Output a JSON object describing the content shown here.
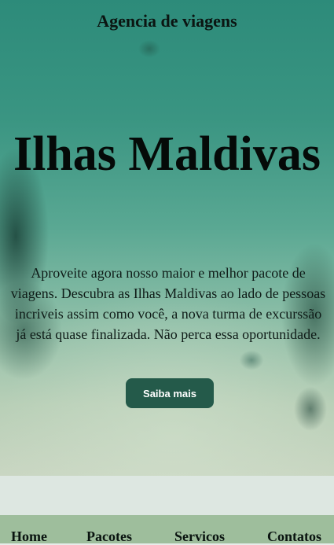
{
  "header": {
    "brand": "Agencia de viagens"
  },
  "hero": {
    "title": "Ilhas Maldivas",
    "description": "Aproveite agora nosso maior e melhor pacote de viagens. Descubra as Ilhas Maldivas ao lado de pessoas incriveis assim como você, a nova turma de excurssão já está quase finalizada. Não perca essa oportunidade.",
    "cta_label": "Saiba mais"
  },
  "nav": {
    "items": [
      "Home",
      "Pacotes",
      "Servicos",
      "Contatos"
    ]
  },
  "colors": {
    "cta_background": "#245a4a",
    "nav_background": "#9ebe9c",
    "band_background": "#dde7e1"
  }
}
